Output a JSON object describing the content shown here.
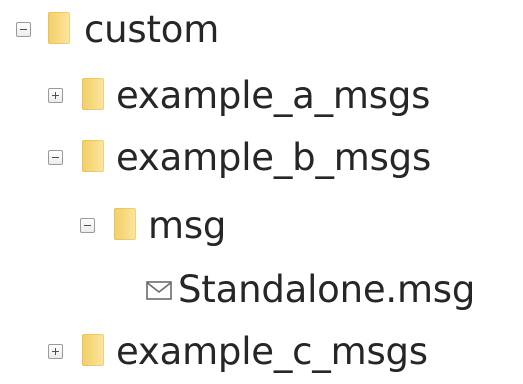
{
  "tree": {
    "nodes": [
      {
        "label": "custom",
        "type": "folder",
        "state": "expanded",
        "icon": "folder-icon",
        "toggle_icon": "collapse-icon"
      },
      {
        "label": "example_a_msgs",
        "type": "folder",
        "state": "collapsed",
        "icon": "folder-icon",
        "toggle_icon": "expand-icon"
      },
      {
        "label": "example_b_msgs",
        "type": "folder",
        "state": "expanded",
        "icon": "folder-icon",
        "toggle_icon": "collapse-icon"
      },
      {
        "label": "msg",
        "type": "folder",
        "state": "expanded",
        "icon": "folder-icon",
        "toggle_icon": "collapse-icon"
      },
      {
        "label": "Standalone.msg",
        "type": "file",
        "icon": "envelope-icon"
      },
      {
        "label": "example_c_msgs",
        "type": "folder",
        "state": "collapsed",
        "icon": "folder-icon",
        "toggle_icon": "expand-icon"
      }
    ]
  },
  "colors": {
    "text": "#262626",
    "folder": "#f8dc85",
    "toggle_border": "#9a9a9a"
  }
}
